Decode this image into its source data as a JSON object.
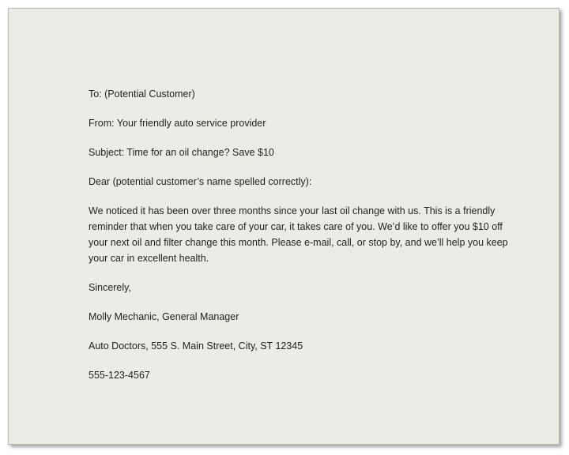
{
  "letter": {
    "to": "To: (Potential Customer)",
    "from": "From: Your friendly auto service provider",
    "subject": "Subject: Time for an oil change? Save $10",
    "salutation": "Dear (potential customer’s name spelled correctly):",
    "body_lines": [
      "We noticed it has been over three months since your last oil change with us. This is a friendly",
      "reminder that when you take care of your car, it takes care of you. We’d like to offer you $10 off",
      "your next oil and filter change this month. Please e-mail, call, or stop by, and we’ll help you keep",
      "your car in excellent health."
    ],
    "closing": "Sincerely,",
    "signature": "Molly Mechanic, General Manager",
    "address": "Auto Doctors, 555 S. Main Street, City, ST 12345",
    "phone": "555-123-4567"
  }
}
